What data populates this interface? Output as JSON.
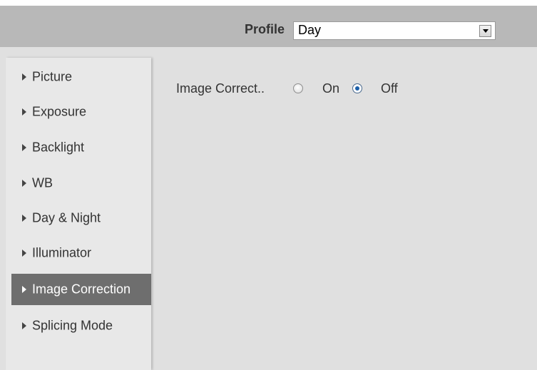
{
  "header": {
    "profile_label": "Profile",
    "profile_value": "Day"
  },
  "sidebar": {
    "items": [
      {
        "label": "Picture",
        "active": false
      },
      {
        "label": "Exposure",
        "active": false
      },
      {
        "label": "Backlight",
        "active": false
      },
      {
        "label": "WB",
        "active": false
      },
      {
        "label": "Day & Night",
        "active": false
      },
      {
        "label": "Illuminator",
        "active": false
      },
      {
        "label": "Image Correction",
        "active": true
      },
      {
        "label": "Splicing Mode",
        "active": false
      }
    ]
  },
  "content": {
    "image_correction": {
      "label": "Image Correct..",
      "options": [
        {
          "label": "On",
          "checked": false
        },
        {
          "label": "Off",
          "checked": true
        }
      ]
    }
  },
  "colors": {
    "header_bg": "#b8b8b8",
    "active_item_bg": "#6e6e6e",
    "panel_bg": "#e0e0e0",
    "radio_checked": "#1c5fa8"
  }
}
